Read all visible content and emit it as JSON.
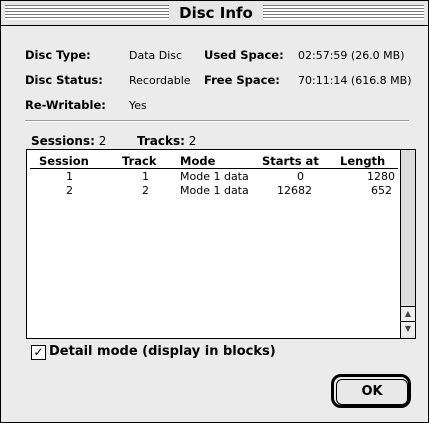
{
  "window": {
    "title": "Disc Info"
  },
  "info": {
    "disc_type_label": "Disc Type:",
    "disc_type_value": "Data Disc",
    "disc_status_label": "Disc Status:",
    "disc_status_value": "Recordable",
    "rewritable_label": "Re-Writable:",
    "rewritable_value": "Yes",
    "used_space_label": "Used Space:",
    "used_space_value": "02:57:59 (26.0 MB)",
    "free_space_label": "Free Space:",
    "free_space_value": "70:11:14 (616.8 MB)"
  },
  "counts": {
    "sessions_label": "Sessions:",
    "sessions_value": "2",
    "tracks_label": "Tracks:",
    "tracks_value": "2"
  },
  "table": {
    "columns": [
      "Session",
      "Track",
      "Mode",
      "Starts at",
      "Length"
    ],
    "rows": [
      [
        "1",
        "1",
        "Mode 1 data",
        "0",
        "1280"
      ],
      [
        "2",
        "2",
        "Mode 1 data",
        "12682",
        "652"
      ]
    ]
  },
  "detail_mode": {
    "checked": true,
    "label": "Detail mode (display in blocks)"
  },
  "buttons": {
    "ok_label": "OK"
  }
}
